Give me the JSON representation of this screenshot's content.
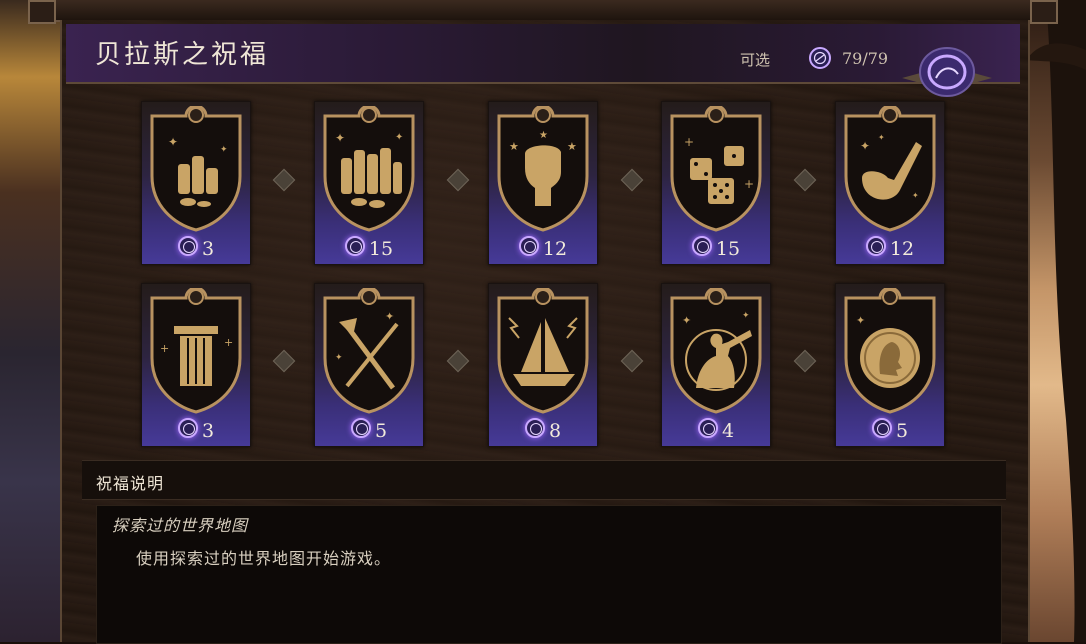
{
  "title": "贝拉斯之祝福",
  "available": {
    "label": "可选",
    "value": "79/79"
  },
  "blessings": [
    {
      "icon": "coin-stack-small-icon",
      "cost": "3"
    },
    {
      "icon": "coin-stack-large-icon",
      "cost": "15"
    },
    {
      "icon": "raised-fist-icon",
      "cost": "12"
    },
    {
      "icon": "dice-icon",
      "cost": "15"
    },
    {
      "icon": "pipe-icon",
      "cost": "12"
    },
    {
      "icon": "pillar-icon",
      "cost": "3"
    },
    {
      "icon": "crossed-weapons-icon",
      "cost": "5"
    },
    {
      "icon": "sailing-ship-icon",
      "cost": "8"
    },
    {
      "icon": "explorer-spyglass-icon",
      "cost": "4"
    },
    {
      "icon": "medallion-icon",
      "cost": "5"
    }
  ],
  "description": {
    "header": "祝福说明",
    "name": "探索过的世界地图",
    "text": "使用探索过的世界地图开始游戏。"
  },
  "colors": {
    "accent": "#a56cff",
    "gold": "#c9a466",
    "card_bottom": "#463a98"
  }
}
